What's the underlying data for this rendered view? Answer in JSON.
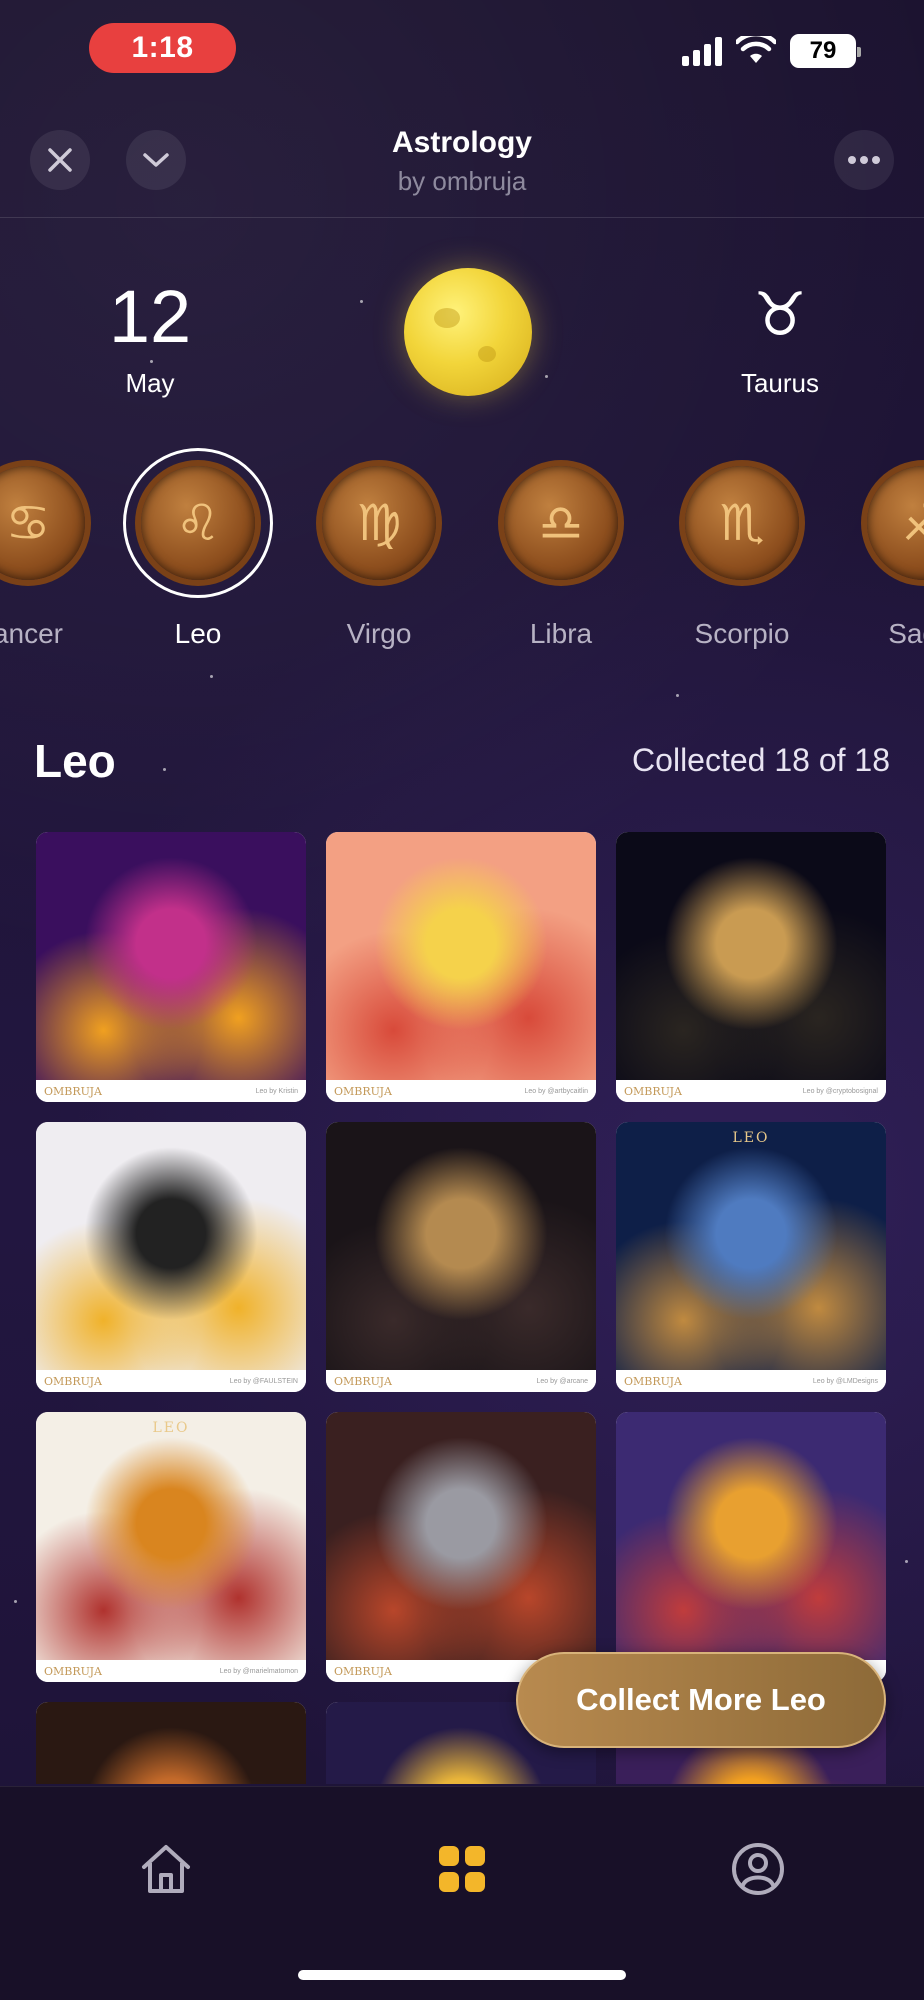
{
  "status_bar": {
    "time": "1:18",
    "battery": "79"
  },
  "header": {
    "title": "Astrology",
    "subtitle": "by ombruja",
    "close_icon": "close-icon",
    "collapse_icon": "chevron-down-icon",
    "more_icon": "more-horizontal-icon"
  },
  "today": {
    "day": "12",
    "month": "May",
    "moon_icon": "full-moon-icon",
    "sign_glyph": "♉",
    "sign_name": "Taurus"
  },
  "zodiac": {
    "selected": "Leo",
    "items": [
      {
        "glyph": "♋",
        "label": "ancer"
      },
      {
        "glyph": "♌",
        "label": "Leo"
      },
      {
        "glyph": "♍",
        "label": "Virgo"
      },
      {
        "glyph": "♎",
        "label": "Libra"
      },
      {
        "glyph": "♏",
        "label": "Scorpio"
      },
      {
        "glyph": "♐",
        "label": "Sagitt"
      }
    ]
  },
  "collection": {
    "title": "Leo",
    "count_text": "Collected 18 of 18",
    "cards": [
      {
        "brand": "OMBRUJA",
        "credit": "Leo by Kristin",
        "label": "",
        "colors": [
          "#3a0f5e",
          "#c2308a",
          "#f0a020"
        ]
      },
      {
        "brand": "OMBRUJA",
        "credit": "Leo by @artbycaitlin",
        "label": "",
        "colors": [
          "#f3a083",
          "#f5d24b",
          "#d84a3a"
        ]
      },
      {
        "brand": "OMBRUJA",
        "credit": "Leo by @cryptobosignal",
        "label": "",
        "colors": [
          "#0b0a18",
          "#c99b52",
          "#2a2520"
        ]
      },
      {
        "brand": "OMBRUJA",
        "credit": "Leo by @FAULSTEIN",
        "label": "",
        "colors": [
          "#efedf1",
          "#222222",
          "#f0b22a"
        ]
      },
      {
        "brand": "OMBRUJA",
        "credit": "Leo by @arcane",
        "label": "",
        "colors": [
          "#1a1418",
          "#b48a50",
          "#3a2a2a"
        ]
      },
      {
        "brand": "OMBRUJA",
        "credit": "Leo by @LMDesigns",
        "label": "LEO",
        "colors": [
          "#0e1f48",
          "#4f7bc0",
          "#c08a40"
        ]
      },
      {
        "brand": "OMBRUJA",
        "credit": "Leo by @marielmatomon",
        "label": "LEO",
        "colors": [
          "#f4efe6",
          "#d9851f",
          "#b0322e"
        ]
      },
      {
        "brand": "OMBRUJA",
        "credit": "",
        "label": "",
        "colors": [
          "#3a2020",
          "#9a9aa2",
          "#b8462a"
        ]
      },
      {
        "brand": "",
        "credit": "",
        "label": "",
        "colors": [
          "#3c2a72",
          "#e8a030",
          "#c03c3c"
        ]
      },
      {
        "brand": "",
        "credit": "",
        "label": "",
        "colors": [
          "#2a1812",
          "#c46a2a",
          "#6e3a1c"
        ]
      },
      {
        "brand": "",
        "credit": "",
        "label": "",
        "colors": [
          "#241a48",
          "#e9b53a",
          "#3a2b6a"
        ]
      },
      {
        "brand": "",
        "credit": "",
        "label": "",
        "colors": [
          "#3a1f5a",
          "#f2a020",
          "#d35a1a"
        ]
      }
    ]
  },
  "collect_button": {
    "label": "Collect More Leo"
  },
  "bottom_nav": [
    {
      "name": "home",
      "icon": "home-icon",
      "active": false
    },
    {
      "name": "collection",
      "icon": "grid-icon",
      "active": true
    },
    {
      "name": "profile",
      "icon": "profile-icon",
      "active": false
    }
  ],
  "accent_color": "#f3b62a"
}
